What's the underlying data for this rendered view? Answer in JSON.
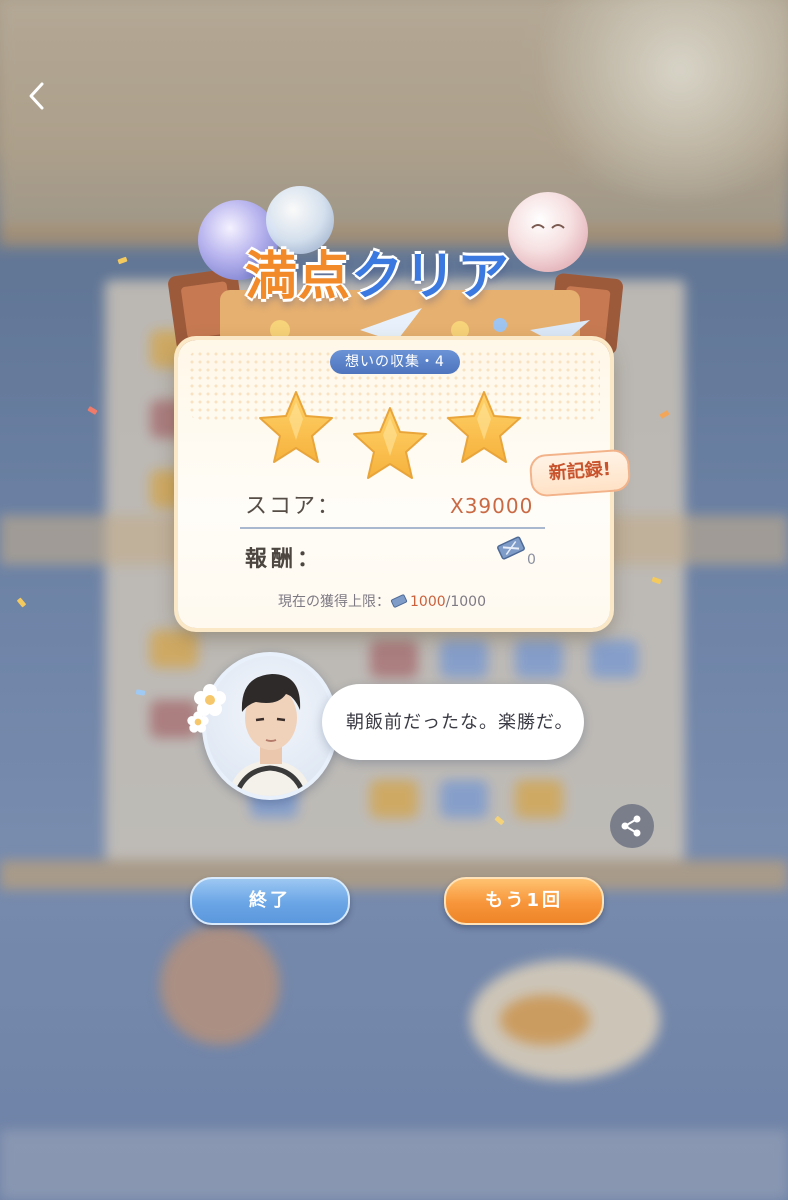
{
  "header": {
    "back_icon": "chevron-left-icon"
  },
  "result": {
    "title_part1": "満点",
    "title_part2": "クリア",
    "stage_label": "想いの収集・4",
    "stars_earned": 3,
    "stars_total": 3,
    "new_record_badge": "新記録!",
    "score_label": "スコア：",
    "score_value": "X39000",
    "reward_label": "報酬：",
    "reward_icon": "ticket-icon",
    "reward_count": "0",
    "limit_label": "現在の獲得上限：",
    "limit_current": "1000",
    "limit_max": "/1000"
  },
  "dialogue": {
    "avatar": "character-portrait",
    "text": "朝飯前だったな。楽勝だ。"
  },
  "actions": {
    "share_icon": "share-icon",
    "end_label": "終了",
    "retry_label": "もう1回"
  },
  "colors": {
    "accent_blue": "#5b97dc",
    "accent_orange": "#ee8428",
    "score_color": "#c96a45",
    "star_color": "#f6b23c"
  }
}
